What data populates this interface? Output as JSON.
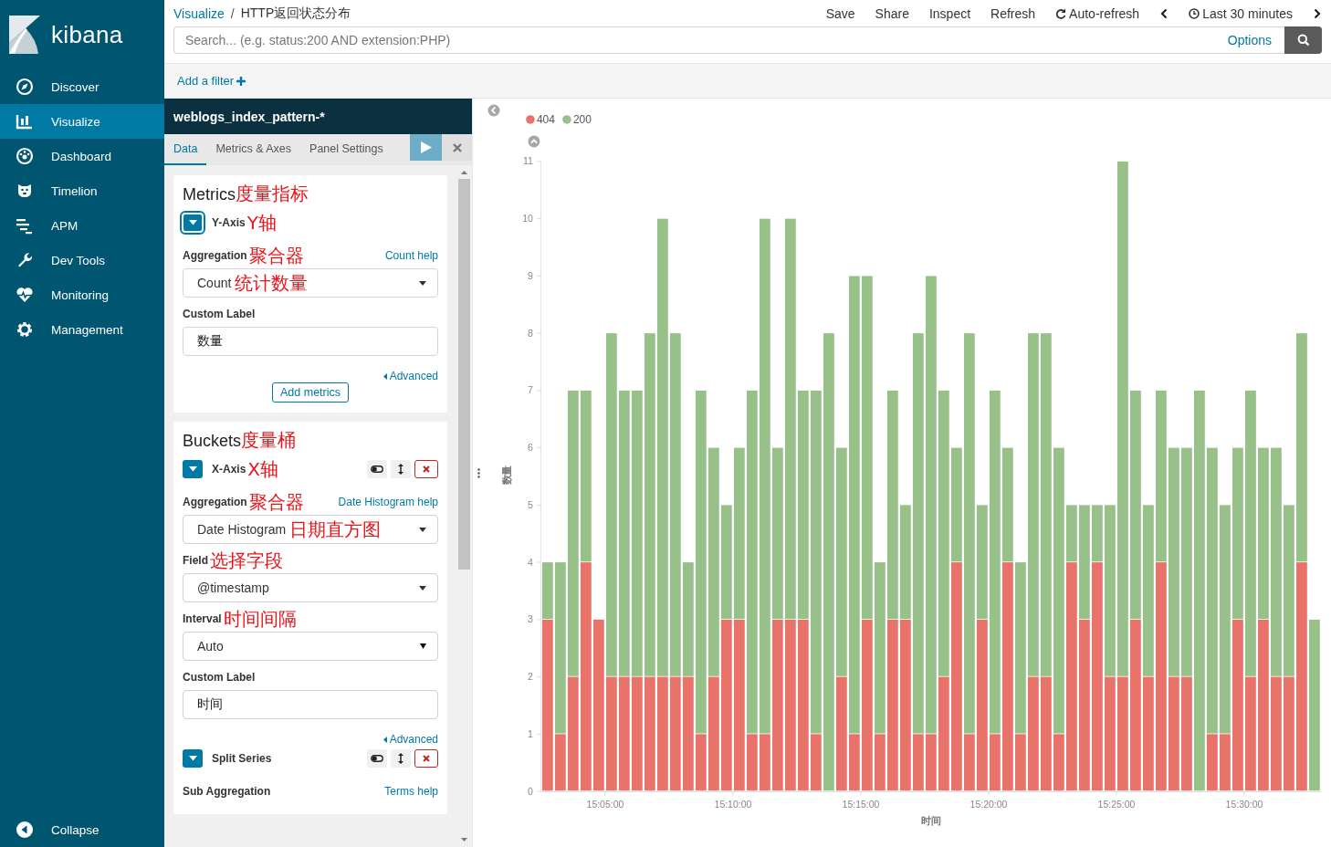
{
  "sidebar": {
    "logo": "kibana",
    "items": [
      {
        "label": "Discover",
        "selected": false
      },
      {
        "label": "Visualize",
        "selected": true
      },
      {
        "label": "Dashboard",
        "selected": false
      },
      {
        "label": "Timelion",
        "selected": false
      },
      {
        "label": "APM",
        "selected": false
      },
      {
        "label": "Dev Tools",
        "selected": false
      },
      {
        "label": "Monitoring",
        "selected": false
      },
      {
        "label": "Management",
        "selected": false
      }
    ],
    "collapse": "Collapse"
  },
  "top_bar": {
    "breadcrumbs": [
      {
        "label": "Visualize",
        "kind": "link"
      },
      {
        "label": "HTTP返回状态分布",
        "kind": "current"
      }
    ],
    "separator": "/",
    "menu": [
      "Save",
      "Share",
      "Inspect",
      "Refresh"
    ],
    "auto_refresh": "Auto-refresh",
    "time_range": "Last 30 minutes"
  },
  "search": {
    "placeholder": "Search... (e.g. status:200 AND extension:PHP)",
    "options": "Options"
  },
  "filter_bar": {
    "add_filter": "Add a filter"
  },
  "editor": {
    "index_pattern": "weblogs_index_pattern-*",
    "tabs": [
      {
        "label": "Data",
        "selected": true
      },
      {
        "label": "Metrics & Axes",
        "selected": false
      },
      {
        "label": "Panel Settings",
        "selected": false
      }
    ],
    "sections": [
      {
        "title": "Metrics",
        "annotation": "度量指标",
        "rows": [
          {
            "kind": "agg_header",
            "label": "Y-Axis",
            "annotation": "Y轴",
            "expanded": true,
            "focused": true,
            "controls": false
          },
          {
            "kind": "label",
            "label": "Aggregation",
            "annotation": "聚合器",
            "help": "Count help"
          },
          {
            "kind": "select",
            "value": "Count",
            "annotation": "统计数量",
            "native": false
          },
          {
            "kind": "label",
            "label": "Custom Label"
          },
          {
            "kind": "text_field",
            "value": "数量"
          },
          {
            "kind": "link",
            "label": "Advanced"
          },
          {
            "kind": "button",
            "label": "Add metrics"
          }
        ]
      },
      {
        "title": "Buckets",
        "annotation": "度量桶",
        "rows": [
          {
            "kind": "agg_header",
            "label": "X-Axis",
            "annotation": "X轴",
            "expanded": true,
            "focused": false,
            "controls": true
          },
          {
            "kind": "label",
            "label": "Aggregation",
            "annotation": "聚合器",
            "help": "Date Histogram help"
          },
          {
            "kind": "select",
            "value": "Date Histogram",
            "annotation": "日期直方图",
            "native": false
          },
          {
            "kind": "label",
            "label": "Field",
            "annotation": "选择字段"
          },
          {
            "kind": "select",
            "value": "@timestamp",
            "native": false
          },
          {
            "kind": "label",
            "label": "Interval",
            "annotation": "时间间隔"
          },
          {
            "kind": "select",
            "value": "Auto",
            "native": true
          },
          {
            "kind": "label",
            "label": "Custom Label"
          },
          {
            "kind": "text_field",
            "value": "时间"
          },
          {
            "kind": "link",
            "label": "Advanced"
          },
          {
            "kind": "agg_header",
            "label": "Split Series",
            "expanded": true,
            "focused": false,
            "controls": true
          },
          {
            "kind": "label",
            "label": "Sub Aggregation",
            "help": "Terms help"
          }
        ]
      }
    ]
  },
  "chart": {
    "chart_data": {
      "type": "bar",
      "stacked": true,
      "xlabel": "时间",
      "ylabel": "数量",
      "legend": "top-left",
      "categories": [
        null,
        null,
        null,
        null,
        null,
        "15:05:00",
        null,
        null,
        null,
        null,
        null,
        null,
        null,
        null,
        null,
        "15:10:00",
        null,
        null,
        null,
        null,
        null,
        null,
        null,
        null,
        null,
        "15:15:00",
        null,
        null,
        null,
        null,
        null,
        null,
        null,
        null,
        null,
        "15:20:00",
        null,
        null,
        null,
        null,
        null,
        null,
        null,
        null,
        null,
        "15:25:00",
        null,
        null,
        null,
        null,
        null,
        null,
        null,
        null,
        null,
        "15:30:00",
        null,
        null,
        null,
        null,
        null
      ],
      "series": [
        {
          "name": "404",
          "color": "#e7736b",
          "values": [
            3,
            1,
            2,
            4,
            3,
            2,
            2,
            2,
            2,
            2,
            2,
            2,
            1,
            2,
            3,
            3,
            1,
            1,
            3,
            3,
            3,
            1,
            0,
            2,
            1,
            3,
            1,
            3,
            3,
            1,
            1,
            2,
            4,
            1,
            3,
            1,
            4,
            1,
            2,
            2,
            1,
            4,
            3,
            4,
            2,
            2,
            3,
            2,
            4,
            2,
            2,
            0,
            1,
            1,
            3,
            2,
            3,
            2,
            2,
            4,
            0
          ]
        },
        {
          "name": "200",
          "color": "#98c18a",
          "values": [
            1,
            3,
            5,
            3,
            0,
            6,
            5,
            5,
            6,
            8,
            6,
            2,
            6,
            4,
            2,
            3,
            6,
            9,
            3,
            7,
            4,
            6,
            8,
            4,
            8,
            6,
            3,
            4,
            2,
            7,
            8,
            5,
            2,
            7,
            2,
            6,
            2,
            3,
            6,
            6,
            5,
            1,
            2,
            1,
            3,
            9,
            4,
            3,
            3,
            4,
            4,
            7,
            5,
            4,
            3,
            5,
            3,
            4,
            3,
            4,
            3
          ]
        }
      ],
      "ylim": [
        0,
        11
      ],
      "yticks": [
        0,
        1,
        2,
        3,
        4,
        5,
        6,
        7,
        8,
        9,
        10,
        11
      ]
    }
  }
}
